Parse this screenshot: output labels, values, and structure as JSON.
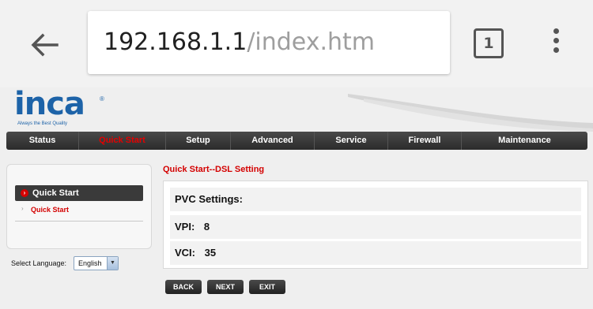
{
  "browser": {
    "url_host": "192.168.1.1",
    "url_path": "/index.htm",
    "tab_count": "1",
    "icons": {
      "back": "arrow-left-icon",
      "menu": "more-vertical-icon"
    }
  },
  "header": {
    "logo_text": "inca",
    "logo_registered": "®",
    "logo_tagline": "Always the Best Quality"
  },
  "nav": {
    "items": [
      {
        "label": "Status"
      },
      {
        "label": "Quick Start"
      },
      {
        "label": "Setup"
      },
      {
        "label": "Advanced"
      },
      {
        "label": "Service"
      },
      {
        "label": "Firewall"
      },
      {
        "label": "Maintenance"
      }
    ],
    "active": "Quick Start"
  },
  "sidebar": {
    "heading": "Quick Start",
    "sub_item": "Quick Start",
    "language_label": "Select Language:",
    "language_value": "English"
  },
  "main": {
    "title": "Quick Start--DSL Setting",
    "pvc_label": "PVC Settings:",
    "vpi_label": "VPI:",
    "vpi_value": "8",
    "vci_label": "VCI:",
    "vci_value": "35"
  },
  "buttons": {
    "back": "BACK",
    "next": "NEXT",
    "exit": "EXIT"
  },
  "colors": {
    "accent_red": "#d40000",
    "logo_blue": "#1d63a8",
    "nav_dark": "#2b2b2b"
  }
}
